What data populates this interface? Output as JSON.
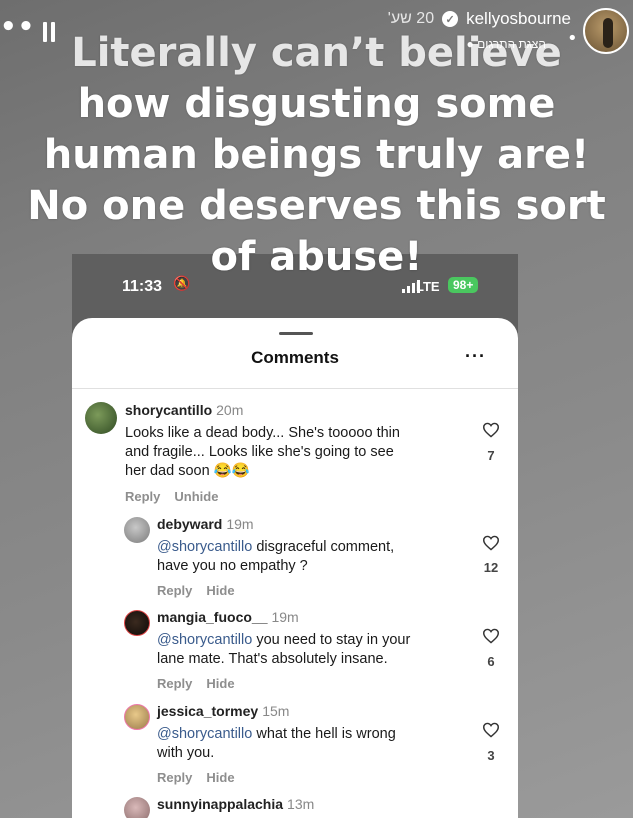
{
  "story": {
    "username": "kellyosbourne",
    "time_ago": "20 שע'",
    "subtitle": "הצגת התרגום",
    "options_icon": "more-dots-icon",
    "progress_icon": "dots-icon",
    "pause_icon": "pause-icon"
  },
  "caption": {
    "lines": [
      "Literally can’t believe",
      "how disgusting some",
      "human beings truly are!",
      "No one deserves this sort",
      "of abuse!"
    ]
  },
  "phone": {
    "status_time": "11:33",
    "network": "LTE",
    "battery": "98+",
    "colors": {
      "battery": "#4ac75f",
      "mention": "#3a5b8c"
    }
  },
  "comments_panel": {
    "title": "Comments",
    "more_icon": "ellipsis-icon",
    "comments": [
      {
        "username": "shorycantillo",
        "time": "20m",
        "lines": [
          "Looks like a dead body... She's tooooo thin",
          "and fragile... Looks like she's going to see",
          "her dad soon 😂😂"
        ],
        "likes": "7",
        "actions": [
          "Reply",
          "Unhide"
        ]
      },
      {
        "username": "debyward",
        "time": "19m",
        "mention": "@shorycantillo",
        "lines": [
          "disgraceful comment,",
          "have you no empathy ?"
        ],
        "likes": "12",
        "actions": [
          "Reply",
          "Hide"
        ]
      },
      {
        "username": "mangia_fuoco__",
        "time": "19m",
        "mention": "@shorycantillo",
        "lines": [
          "you need to stay in your",
          "lane mate. That's absolutely insane."
        ],
        "likes": "6",
        "actions": [
          "Reply",
          "Hide"
        ]
      },
      {
        "username": "jessica_tormey",
        "time": "15m",
        "mention": "@shorycantillo",
        "lines": [
          "what the hell is wrong",
          "with you."
        ],
        "likes": "3",
        "actions": [
          "Reply",
          "Hide"
        ]
      },
      {
        "username": "sunnyinappalachia",
        "time": "13m"
      }
    ]
  }
}
